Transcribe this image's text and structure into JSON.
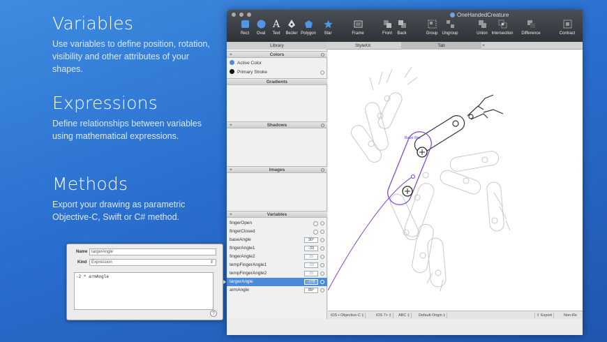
{
  "promo": {
    "variables": {
      "title": "Variables",
      "text": "Use variables to define position, rotation, visibility and other attributes of your shapes."
    },
    "expressions": {
      "title": "Expressions",
      "text": "Define relationships between variables using mathematical expressions."
    },
    "methods": {
      "title": "Methods",
      "text": "Export your drawing as parametric Objective-C, Swift or C# method."
    }
  },
  "window": {
    "title": "OneHandedCreature",
    "toolbar": [
      "Rect",
      "Oval",
      "Text",
      "Bezier",
      "Polygon",
      "Star",
      "Frame",
      "Front",
      "Back",
      "Group",
      "Ungroup",
      "Union",
      "Intersection",
      "Difference",
      "Contract"
    ],
    "tabs": [
      "Library",
      "StyleKit",
      "Tab",
      "+"
    ]
  },
  "library": {
    "colors_header": "Colors",
    "colors": [
      {
        "name": "Active Color",
        "color": "#4a8ad8"
      },
      {
        "name": "Primary Stroke",
        "color": "#111111"
      }
    ],
    "gradients_header": "Gradients",
    "shadows_header": "Shadows",
    "images_header": "Images",
    "variables_header": "Variables",
    "plus": "+",
    "variables": [
      {
        "name": "fingerOpen",
        "value": ""
      },
      {
        "name": "fingerClosed",
        "value": ""
      },
      {
        "name": "baseAngle",
        "value": "30°"
      },
      {
        "name": "fingerAngle1",
        "value": "-33"
      },
      {
        "name": "fingerAngle2",
        "value": "33"
      },
      {
        "name": "tempFingerAngle1",
        "value": "-33"
      },
      {
        "name": "tempFingerAngle2",
        "value": "33"
      },
      {
        "name": "targerAngle",
        "value": "-178"
      },
      {
        "name": "armAngle",
        "value": "89°"
      }
    ]
  },
  "canvas": {
    "label": "Base Rot"
  },
  "bottombar": [
    "iOS • Objective-C ‡",
    "iOS 7+ ‡",
    "ABC ‡",
    "Default Origin ‡",
    "Export",
    "Non-Re"
  ],
  "editor": {
    "name_label": "Name",
    "name_value": "targerAngle",
    "kind_label": "Kind",
    "kind_value": "Expression",
    "code": "-2 * armAngle",
    "help": "?"
  },
  "colors": {
    "accent": "#4a8ad8",
    "selection": "#7b3fd1"
  }
}
